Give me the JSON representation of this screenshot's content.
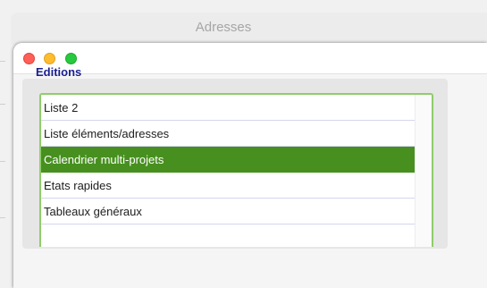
{
  "background_window": {
    "title": "Adresses"
  },
  "front_window": {
    "traffic_lights": {
      "close": "#fe5f57",
      "minimize": "#febc2e",
      "maximize": "#28c840"
    }
  },
  "editions": {
    "label": "Editions",
    "selected_index": 2,
    "items": [
      {
        "label": "Liste 2"
      },
      {
        "label": "Liste éléments/adresses"
      },
      {
        "label": "Calendrier multi-projets"
      },
      {
        "label": "Etats rapides"
      },
      {
        "label": "Tableaux généraux"
      },
      {
        "label": ""
      }
    ]
  },
  "colors": {
    "accent_selection": "#47901f",
    "frame_highlight": "#8fcd6a",
    "label_color": "#1a1f8f"
  }
}
